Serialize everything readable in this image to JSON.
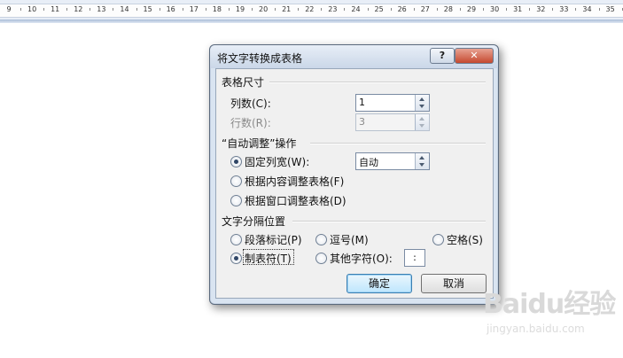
{
  "ruler": {
    "numbers": [
      "9",
      "10",
      "11",
      "12",
      "13",
      "14",
      "15",
      "16",
      "17",
      "18",
      "19",
      "20",
      "21",
      "22",
      "23",
      "24",
      "25",
      "26",
      "27",
      "28",
      "29",
      "30",
      "31",
      "32",
      "33",
      "34",
      "35"
    ]
  },
  "dialog": {
    "title": "将文字转换成表格",
    "help_label": "?",
    "close_label": "✕",
    "table_size": {
      "heading": "表格尺寸",
      "columns_label": "列数(C):",
      "columns_value": "1",
      "rows_label": "行数(R):",
      "rows_value": "3"
    },
    "autofit": {
      "heading": "“自动调整”操作",
      "fixed_width_label": "固定列宽(W):",
      "fixed_width_value": "自动",
      "content_label": "根据内容调整表格(F)",
      "window_label": "根据窗口调整表格(D)",
      "selected": "fixed_width"
    },
    "separator": {
      "heading": "文字分隔位置",
      "paragraph_label": "段落标记(P)",
      "comma_label": "逗号(M)",
      "space_label": "空格(S)",
      "tab_label": "制表符(T)",
      "other_label": "其他字符(O):",
      "other_value": ":",
      "selected": "tab"
    },
    "ok_label": "确定",
    "cancel_label": "取消"
  },
  "watermark": {
    "brand": "Baidu经验",
    "url": "jingyan.baidu.com"
  }
}
